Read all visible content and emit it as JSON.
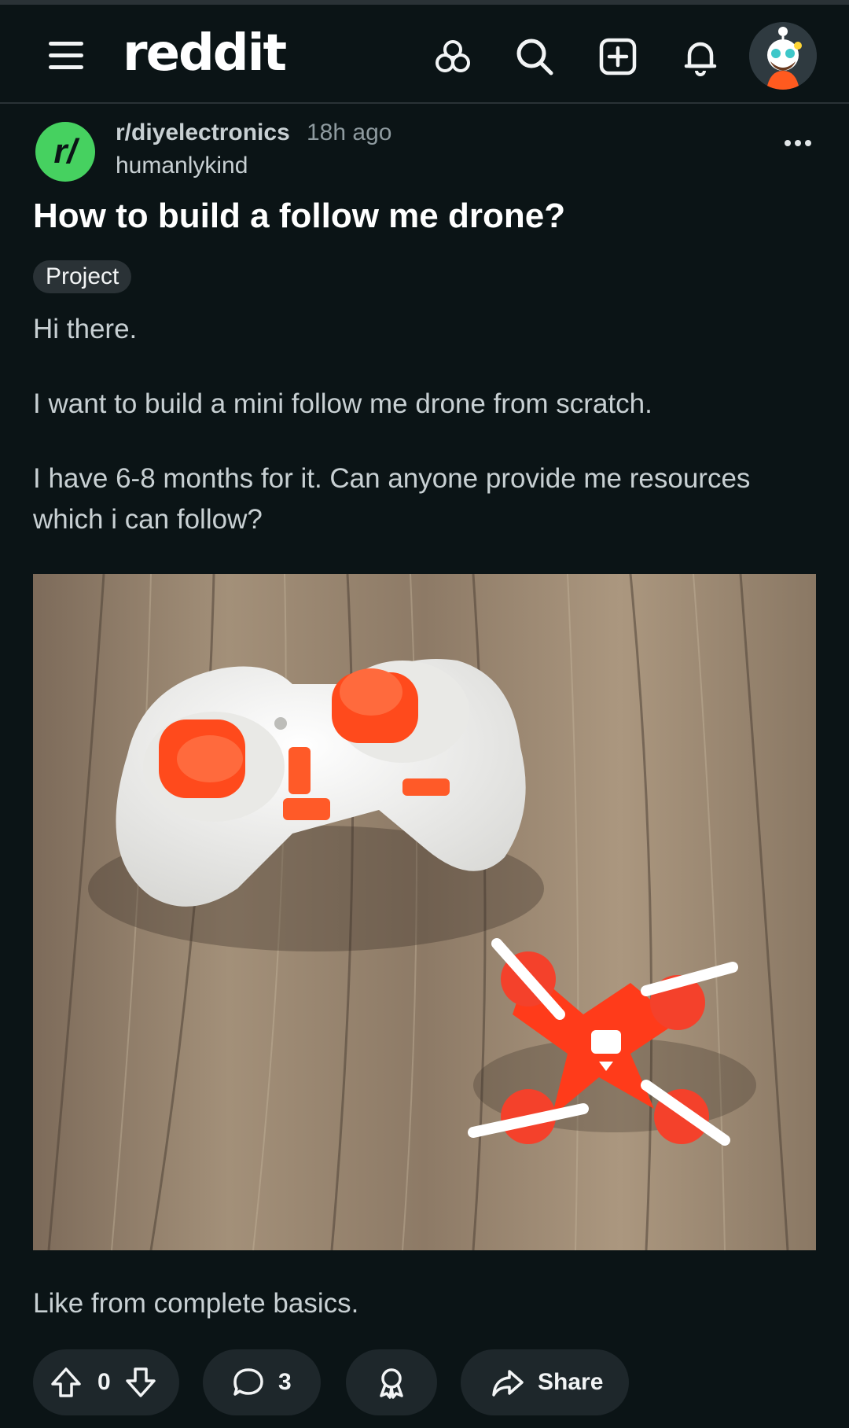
{
  "app": {
    "brand": "reddit"
  },
  "header": {
    "icons": [
      "menu-icon",
      "popular-icon",
      "search-icon",
      "create-post-icon",
      "notifications-icon",
      "user-avatar"
    ]
  },
  "post": {
    "subreddit": "r/diyelectronics",
    "subreddit_icon_text": "r/",
    "age": "18h ago",
    "author": "humanlykind",
    "title": "How to build a follow me drone?",
    "flair": "Project",
    "body": [
      "Hi there.",
      "I want to build a mini follow me drone from scratch.",
      "I have 6-8 months for it. Can anyone provide me resources which i can follow?"
    ],
    "footer_text": "Like from complete basics.",
    "image_alt": "white remote controller with orange joysticks and a small orange quadcopter drone on a wooden table"
  },
  "actions": {
    "score": "0",
    "comments": "3",
    "share_label": "Share"
  },
  "colors": {
    "background": "#0b1416",
    "accent_green": "#46d160",
    "pill_background": "#1e272b"
  }
}
